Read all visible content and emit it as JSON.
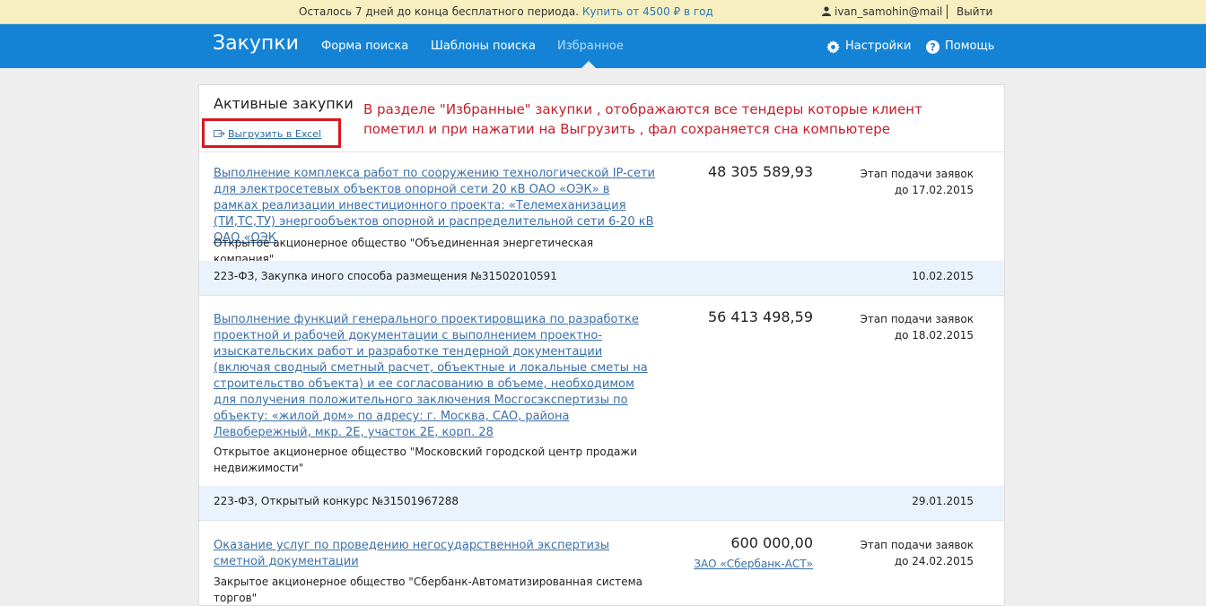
{
  "trial": {
    "text": "Осталось 7 дней до конца бесплатного периода.",
    "buy_link": "Купить от 4500 ₽ в год"
  },
  "user": {
    "name": "ivan_samohin@mail",
    "logout": "Выйти"
  },
  "nav": {
    "brand": "Закупки",
    "links": [
      "Форма поиска",
      "Шаблоны поиска",
      "Избранное"
    ],
    "settings": "Настройки",
    "help": "Помощь"
  },
  "panel": {
    "title": "Активные закупки",
    "export": "Выгрузить в Excel",
    "annotation": "В разделе \"Избранные\" закупки , отображаются все тендеры которые клиент пометил и при нажатии на Выгрузить , фал сохраняется сна компьютере"
  },
  "items": [
    {
      "title": "Выполнение комплекса работ по сооружению технологической IP-сети для электросетевых объектов опорной сети 20 кВ ОАО «ОЭК» в рамках реализации инвестиционного проекта: «Телемеханизация (ТИ,ТС,ТУ) энергообъектов опорной и распределительной сети 6-20 кВ ОАО «ОЭК",
      "org": "Открытое акционерное общество \"Объединенная энергетическая компания\"",
      "price": "48 305 589,93",
      "stage": "Этап подачи заявок",
      "deadline": "до 17.02.2015",
      "law": "223-ФЗ, Закупка иного способа размещения №31502010591",
      "date": "10.02.2015"
    },
    {
      "title": "Выполнение функций генерального проектировщика по разработке проектной и рабочей документации с выполнением проектно-изыскательских работ и разработке тендерной документации (включая сводный сметный расчет, объектные и локальные сметы на строительство объекта) и ее согласованию в объеме, необходимом для получения положительного заключения Мосгосэкспертизы по объекту: «жилой дом» по адресу: г. Москва, САО, района Левобережный, мкр. 2Е, участок 2Е, корп. 28",
      "org": "Открытое акционерное общество \"Московский городской центр продажи недвижимости\"",
      "price": "56 413 498,59",
      "stage": "Этап подачи заявок",
      "deadline": "до 18.02.2015",
      "law": "223-ФЗ, Открытый конкурс №31501967288",
      "date": "29.01.2015"
    },
    {
      "title": "Оказание услуг по проведению негосударственной экспертизы сметной документации",
      "org": "Закрытое акционерное общество \"Сбербанк-Автоматизированная система торгов\"",
      "price": "600 000,00",
      "platform": "ЗАО «Сбербанк-АСТ»",
      "stage": "Этап подачи заявок",
      "deadline": "до 24.02.2015"
    }
  ],
  "colors": {
    "nav_bg": "#1483d5",
    "trial_bg": "#f7efc0",
    "link": "#3b6fa9",
    "highlight": "#d8191d"
  }
}
